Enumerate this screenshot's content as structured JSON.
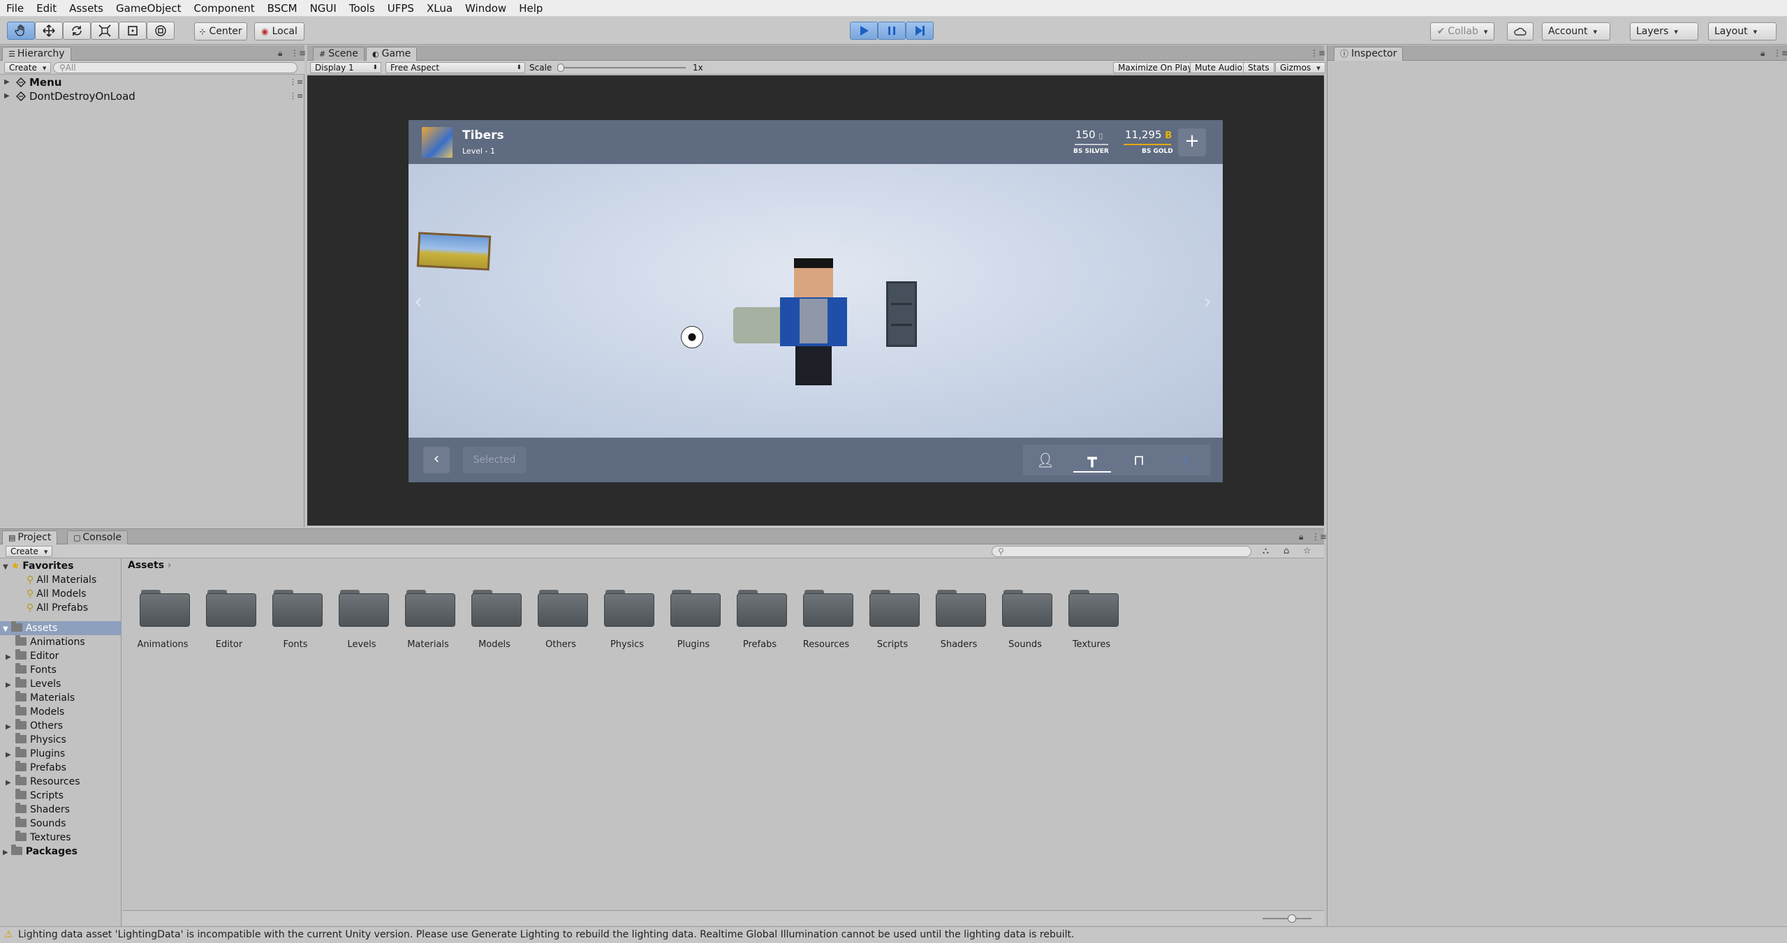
{
  "menubar": [
    "File",
    "Edit",
    "Assets",
    "GameObject",
    "Component",
    "BSCM",
    "NGUI",
    "Tools",
    "UFPS",
    "XLua",
    "Window",
    "Help"
  ],
  "toolbar": {
    "tools": [
      "hand-tool",
      "move-tool",
      "rotate-tool",
      "scale-tool",
      "rect-tool",
      "transform-tool"
    ],
    "pivot_label": "Center",
    "space_label": "Local",
    "collab_label": "Collab",
    "account_label": "Account",
    "layers_label": "Layers",
    "layout_label": "Layout"
  },
  "hierarchy": {
    "tab": "Hierarchy",
    "create": "Create",
    "search_placeholder": "All",
    "items": [
      "Menu",
      "DontDestroyOnLoad"
    ]
  },
  "center_tabs": {
    "scene": "Scene",
    "game": "Game"
  },
  "game_bar": {
    "display": "Display 1",
    "aspect": "Free Aspect",
    "scale_label": "Scale",
    "scale_value": "1x",
    "maximize": "Maximize On Play",
    "mute": "Mute Audio",
    "stats": "Stats",
    "gizmos": "Gizmos"
  },
  "game": {
    "player_name": "Tibers",
    "level": "Level - 1",
    "silver_value": "150",
    "silver_label": "BS SILVER",
    "gold_value": "11,295",
    "gold_label": "BS GOLD",
    "add_label": "+",
    "selected_label": "Selected"
  },
  "inspector": {
    "tab": "Inspector"
  },
  "project": {
    "tab_project": "Project",
    "tab_console": "Console",
    "create": "Create",
    "favorites_label": "Favorites",
    "favorites": [
      "All Materials",
      "All Models",
      "All Prefabs"
    ],
    "assets_label": "Assets",
    "assets_tree": [
      {
        "name": "Animations",
        "expandable": false
      },
      {
        "name": "Editor",
        "expandable": true
      },
      {
        "name": "Fonts",
        "expandable": false
      },
      {
        "name": "Levels",
        "expandable": true
      },
      {
        "name": "Materials",
        "expandable": false
      },
      {
        "name": "Models",
        "expandable": false
      },
      {
        "name": "Others",
        "expandable": true
      },
      {
        "name": "Physics",
        "expandable": false
      },
      {
        "name": "Plugins",
        "expandable": true
      },
      {
        "name": "Prefabs",
        "expandable": false
      },
      {
        "name": "Resources",
        "expandable": true
      },
      {
        "name": "Scripts",
        "expandable": false
      },
      {
        "name": "Shaders",
        "expandable": false
      },
      {
        "name": "Sounds",
        "expandable": false
      },
      {
        "name": "Textures",
        "expandable": false
      }
    ],
    "packages_label": "Packages",
    "breadcrumb": "Assets",
    "folders": [
      "Animations",
      "Editor",
      "Fonts",
      "Levels",
      "Materials",
      "Models",
      "Others",
      "Physics",
      "Plugins",
      "Prefabs",
      "Resources",
      "Scripts",
      "Shaders",
      "Sounds",
      "Textures"
    ]
  },
  "status": "Lighting data asset 'LightingData' is incompatible with the current Unity version. Please use Generate Lighting to rebuild the lighting data.  Realtime Global Illumination cannot be used until the lighting data is rebuilt."
}
